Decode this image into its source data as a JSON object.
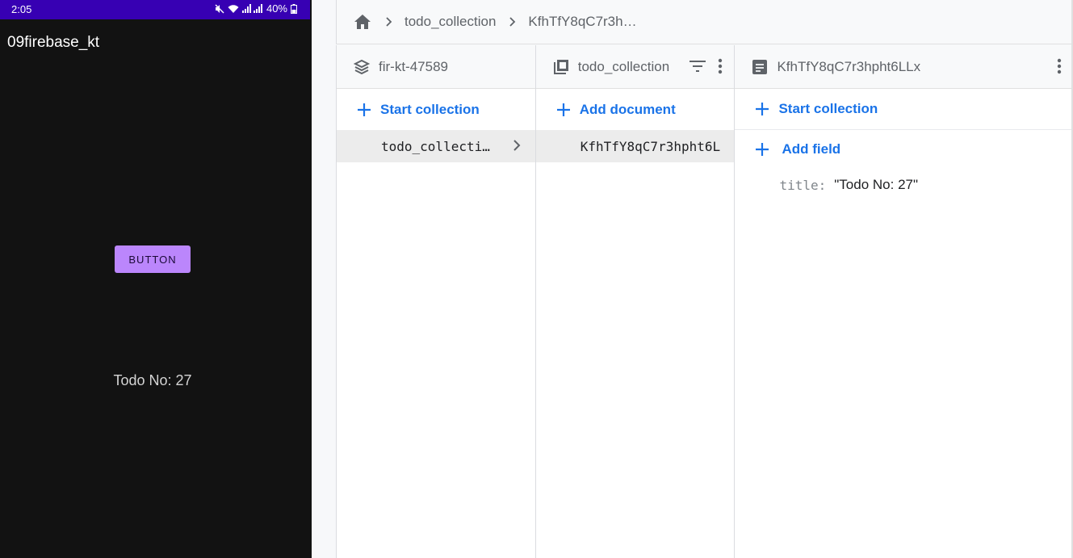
{
  "phone": {
    "status_time": "2:05",
    "battery": "40%",
    "app_title": "09firebase_kt",
    "button_label": "BUTTON",
    "todo_text": "Todo No: 27"
  },
  "breadcrumb": {
    "items": [
      "todo_collection",
      "KfhTfY8qC7r3h…"
    ]
  },
  "panels": {
    "root": {
      "title": "fir-kt-47589",
      "action": "Start collection",
      "items": [
        "todo_collecti…"
      ]
    },
    "collection": {
      "title": "todo_collection",
      "action": "Add document",
      "items": [
        "KfhTfY8qC7r3hpht6L"
      ]
    },
    "document": {
      "title": "KfhTfY8qC7r3hpht6LLx",
      "action": "Start collection",
      "add_field": "Add field",
      "fields": [
        {
          "key": "title:",
          "value": "\"Todo No: 27\""
        }
      ]
    }
  },
  "colors": {
    "phone_bg": "#121212",
    "status_bar": "#3700b3",
    "button": "#bb86fc",
    "link_blue": "#1a73e8"
  }
}
